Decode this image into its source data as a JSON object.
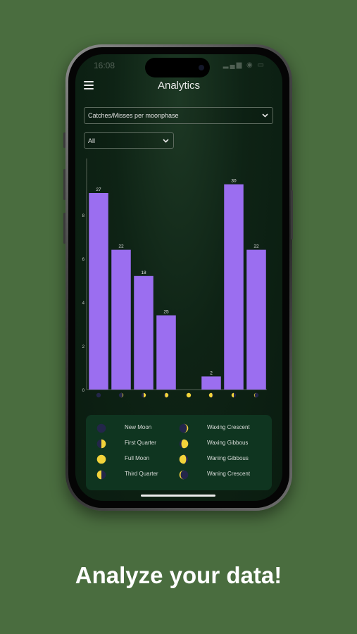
{
  "status_bar": {
    "time": "16:08",
    "icons": "signal wifi battery"
  },
  "header": {
    "title": "Analytics",
    "menu_icon": "hamburger-menu-icon"
  },
  "filters": {
    "metric": {
      "selected": "Catches/Misses per moonphase"
    },
    "range": {
      "selected": "All"
    }
  },
  "chart_data": {
    "type": "bar",
    "categories": [
      "New Moon",
      "Waxing Crescent",
      "First Quarter",
      "Waxing Gibbous",
      "Full Moon",
      "Waning Gibbous",
      "Third Quarter",
      "Waning Crescent"
    ],
    "values": [
      9,
      6.4,
      5.2,
      3.4,
      0,
      0.6,
      9.4,
      6.4
    ],
    "data_labels": [
      "27",
      "22",
      "18",
      "25",
      "",
      "2",
      "30",
      "22"
    ],
    "y_ticks": [
      "0",
      "2",
      "4",
      "6",
      "8"
    ],
    "ylim": [
      0,
      10
    ],
    "bar_color": "#9b6ef0",
    "grid": false,
    "title": "",
    "xlabel": "",
    "ylabel": ""
  },
  "legend": {
    "items": [
      {
        "label": "New Moon",
        "phase": "new"
      },
      {
        "label": "Waxing Crescent",
        "phase": "waxing-crescent"
      },
      {
        "label": "First Quarter",
        "phase": "first-quarter"
      },
      {
        "label": "Waxing Gibbous",
        "phase": "waxing-gibbous"
      },
      {
        "label": "Full Moon",
        "phase": "full"
      },
      {
        "label": "Waning Gibbous",
        "phase": "waning-gibbous"
      },
      {
        "label": "Third Quarter",
        "phase": "third-quarter"
      },
      {
        "label": "Waning Crescent",
        "phase": "waning-crescent"
      }
    ]
  },
  "moon_colors": {
    "lit": "#f2d33a",
    "dark": "#23264a"
  },
  "tagline": "Analyze your data!",
  "colors": {
    "background": "#4a6d3f",
    "accent": "#9b6ef0"
  }
}
